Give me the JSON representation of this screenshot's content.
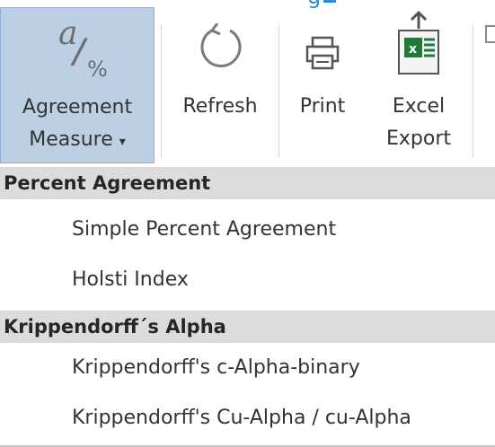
{
  "ribbon": {
    "agreement_label_1": "Agreement",
    "agreement_label_2": "Measure",
    "agreement_caret": "▾",
    "agreement_icon_a": "a",
    "agreement_icon_slash": "/",
    "agreement_icon_pct": "%",
    "refresh_label": "Refresh",
    "print_label": "Print",
    "excel_label_1": "Excel",
    "excel_label_2": "Export",
    "excel_icon_letter": "x"
  },
  "menu": {
    "sections": [
      {
        "header": "Percent Agreement",
        "items": [
          "Simple Percent Agreement",
          "Holsti Index"
        ]
      },
      {
        "header": "Krippendorff´s Alpha",
        "items": [
          "Krippendorff's c-Alpha-binary",
          "Krippendorff's Cu-Alpha / cu-Alpha"
        ]
      }
    ]
  },
  "colors": {
    "selected_bg": "#bdd0e3",
    "selected_border": "#8fb0d2",
    "header_bg": "#dcdcdc",
    "excel_green": "#1f7a3a",
    "title_blue": "#2e8bd6"
  },
  "icons": [
    "agreement-measure-icon",
    "refresh-icon",
    "printer-icon",
    "excel-icon"
  ]
}
